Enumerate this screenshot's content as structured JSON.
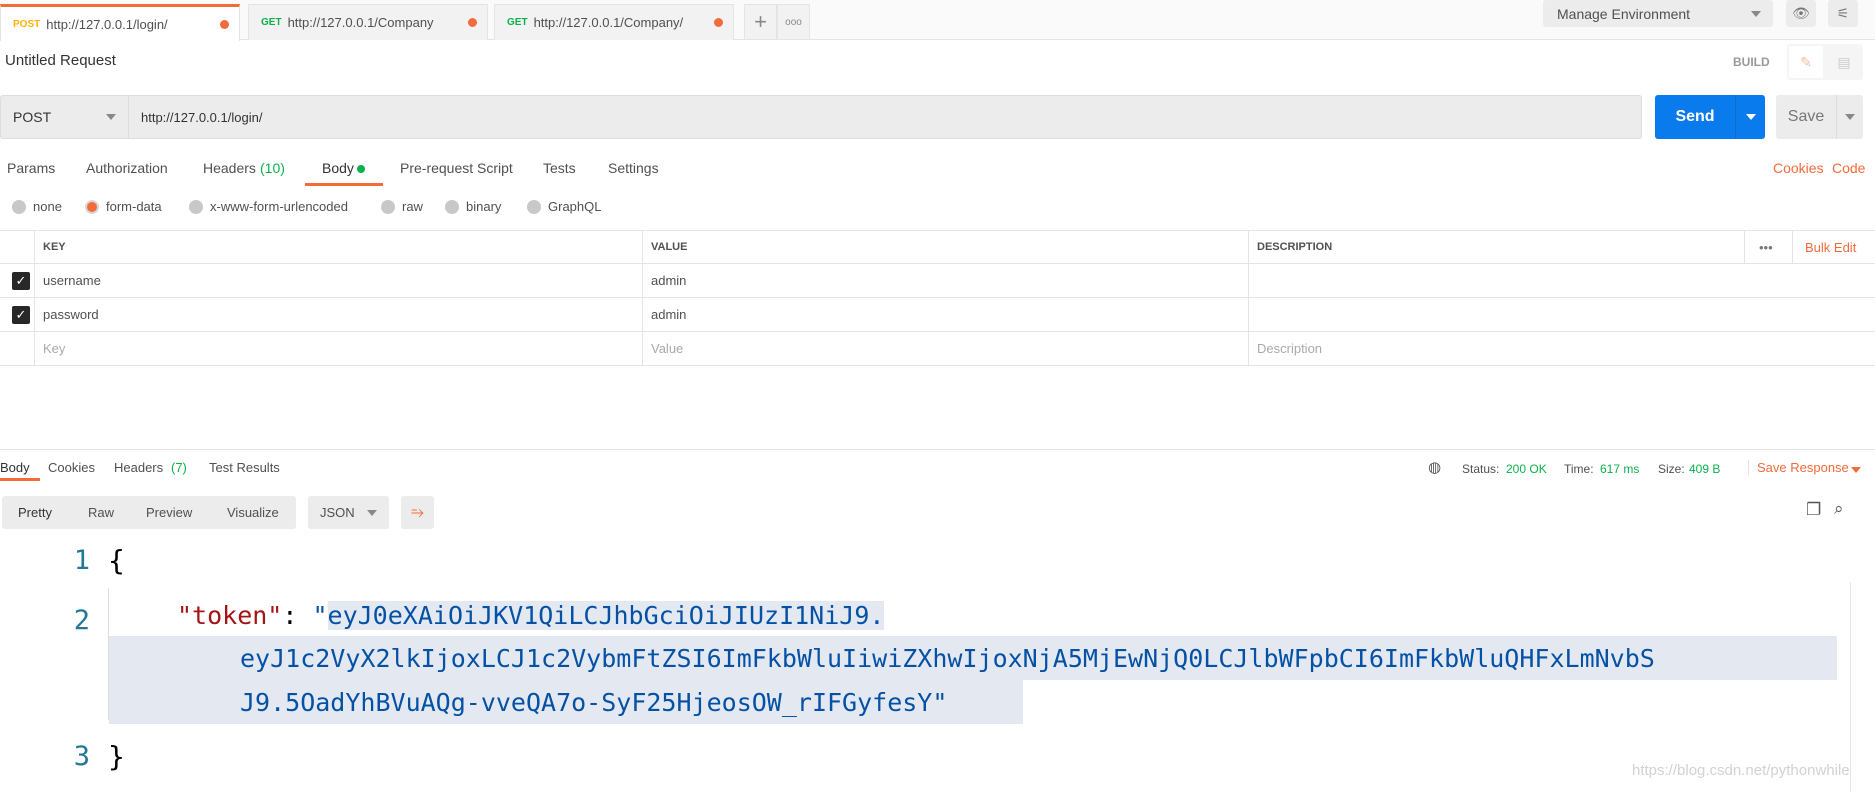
{
  "tabs": [
    {
      "method": "POST",
      "url": "http://127.0.0.1/login/",
      "active": true
    },
    {
      "method": "GET",
      "url": "http://127.0.0.1/Company"
    },
    {
      "method": "GET",
      "url": "http://127.0.0.1/Company/"
    }
  ],
  "environment": "Manage Environment",
  "request": {
    "title": "Untitled Request",
    "build": "BUILD",
    "method": "POST",
    "url": "http://127.0.0.1/login/",
    "send": "Send",
    "save": "Save"
  },
  "request_tabs": [
    "Params",
    "Authorization",
    "Headers",
    "(10)",
    "Body",
    "Pre-request Script",
    "Tests",
    "Settings"
  ],
  "links": {
    "cookies": "Cookies",
    "code": "Code"
  },
  "body_types": [
    "none",
    "form-data",
    "x-www-form-urlencoded",
    "raw",
    "binary",
    "GraphQL"
  ],
  "table": {
    "headers": [
      "KEY",
      "VALUE",
      "DESCRIPTION"
    ],
    "more": "•••",
    "bulk_edit": "Bulk Edit",
    "rows": [
      {
        "key": "username",
        "value": "admin",
        "checked": true
      },
      {
        "key": "password",
        "value": "admin",
        "checked": true
      }
    ],
    "placeholders": {
      "key": "Key",
      "value": "Value",
      "description": "Description"
    }
  },
  "response": {
    "tabs": [
      "Body",
      "Cookies",
      "Headers",
      "(7)",
      "Test Results"
    ],
    "status_label": "Status:",
    "status": "200 OK",
    "time_label": "Time:",
    "time": "617 ms",
    "size_label": "Size:",
    "size": "409 B",
    "save_response": "Save Response",
    "views": [
      "Pretty",
      "Raw",
      "Preview",
      "Visualize"
    ],
    "format": "JSON",
    "lines": [
      "1",
      "2",
      "3"
    ],
    "open_brace": "{",
    "close_brace": "}",
    "key": "\"token\"",
    "colon": ": ",
    "quote": "\"",
    "token_parts": [
      "eyJ0eXAiOiJKV1QiLCJhbGciOiJIUzI1NiJ9.",
      "eyJ1c2VyX2lkIjoxLCJ1c2VybmFtZSI6ImFkbWluIiwiZXhwIjoxNjA5MjEwNjQ0LCJlbWFpbCI6ImFkbWluQHFxLmNvbS",
      "J9.5OadYhBVuAQg-vveQA7o-SyF25HjeosOW_rIFGyfesY"
    ]
  },
  "watermark": "https://blog.csdn.net/pythonwhile",
  "colors": {
    "accent": "#f26b3a",
    "send": "#097bed",
    "success": "#0cb14b"
  }
}
